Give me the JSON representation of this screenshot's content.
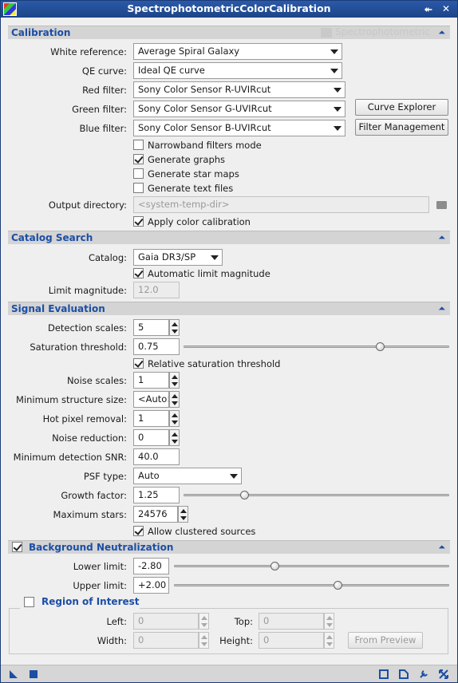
{
  "window": {
    "title": "SpectrophotometricColorCalibration",
    "shade_glyph": "⯬",
    "close_glyph": "✕",
    "collapse_glyph": "⏶"
  },
  "calibration": {
    "header": "Calibration",
    "ghost_label": "Spectrophotometric",
    "white_reference_label": "White reference:",
    "white_reference_value": "Average Spiral Galaxy",
    "qe_curve_label": "QE curve:",
    "qe_curve_value": "Ideal QE curve",
    "red_filter_label": "Red filter:",
    "red_filter_value": "Sony Color Sensor R-UVIRcut",
    "green_filter_label": "Green filter:",
    "green_filter_value": "Sony Color Sensor G-UVIRcut",
    "blue_filter_label": "Blue filter:",
    "blue_filter_value": "Sony Color Sensor B-UVIRcut",
    "curve_explorer_button": "Curve Explorer",
    "filter_management_button": "Filter Management",
    "narrowband_label": "Narrowband filters mode",
    "narrowband_checked": false,
    "generate_graphs_label": "Generate graphs",
    "generate_graphs_checked": true,
    "generate_star_maps_label": "Generate star maps",
    "generate_star_maps_checked": false,
    "generate_text_files_label": "Generate text files",
    "generate_text_files_checked": false,
    "output_directory_label": "Output directory:",
    "output_directory_placeholder": "<system-temp-dir>",
    "apply_color_calibration_label": "Apply color calibration",
    "apply_color_calibration_checked": true
  },
  "catalog_search": {
    "header": "Catalog Search",
    "catalog_label": "Catalog:",
    "catalog_value": "Gaia DR3/SP",
    "auto_limit_label": "Automatic limit magnitude",
    "auto_limit_checked": true,
    "limit_magnitude_label": "Limit magnitude:",
    "limit_magnitude_value": "12.0"
  },
  "signal_evaluation": {
    "header": "Signal Evaluation",
    "detection_scales_label": "Detection scales:",
    "detection_scales_value": "5",
    "saturation_threshold_label": "Saturation threshold:",
    "saturation_threshold_value": "0.75",
    "saturation_threshold_level": 0.75,
    "relative_saturation_label": "Relative saturation threshold",
    "relative_saturation_checked": true,
    "noise_scales_label": "Noise scales:",
    "noise_scales_value": "1",
    "min_structure_label": "Minimum structure size:",
    "min_structure_value": "<Auto>",
    "hot_pixel_label": "Hot pixel removal:",
    "hot_pixel_value": "1",
    "noise_reduction_label": "Noise reduction:",
    "noise_reduction_value": "0",
    "min_snr_label": "Minimum detection SNR:",
    "min_snr_value": "40.0",
    "psf_type_label": "PSF type:",
    "psf_type_value": "Auto",
    "growth_factor_label": "Growth factor:",
    "growth_factor_value": "1.25",
    "growth_factor_level": 0.22,
    "max_stars_label": "Maximum stars:",
    "max_stars_value": "24576",
    "allow_clustered_label": "Allow clustered sources",
    "allow_clustered_checked": true
  },
  "background_neutralization": {
    "header": "Background Neutralization",
    "enabled": true,
    "lower_limit_label": "Lower limit:",
    "lower_limit_value": "-2.80",
    "lower_limit_level": 0.36,
    "upper_limit_label": "Upper limit:",
    "upper_limit_value": "+2.00",
    "upper_limit_level": 0.6,
    "roi": {
      "header": "Region of Interest",
      "enabled": false,
      "left_label": "Left:",
      "left_value": "0",
      "top_label": "Top:",
      "top_value": "0",
      "width_label": "Width:",
      "width_value": "0",
      "height_label": "Height:",
      "height_value": "0",
      "from_preview_button": "From Preview"
    }
  },
  "icons": {
    "new_instance": "triangle-icon",
    "apply_global": "square-icon",
    "browse_documentation": "window-icon",
    "new_document": "document-icon",
    "preferences": "wrench-icon",
    "reset": "reset-icon",
    "folder": "folder-icon"
  },
  "colors": {
    "title_bar": "#1c4488",
    "section_header_text": "#1c4ea5",
    "bottom_icon": "#1c4ea5"
  }
}
